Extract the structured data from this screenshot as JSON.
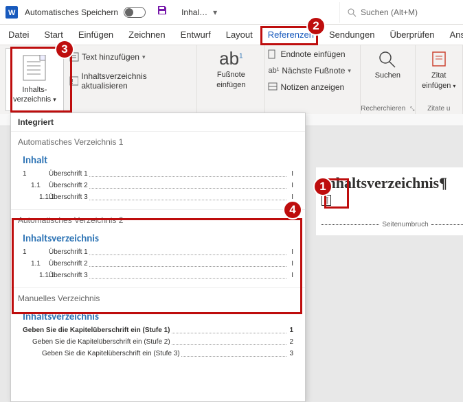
{
  "titlebar": {
    "autosave_label": "Automatisches Speichern",
    "doc_name": "Inhal…",
    "search_placeholder": "Suchen (Alt+M)"
  },
  "tabs": [
    "Datei",
    "Start",
    "Einfügen",
    "Zeichnen",
    "Entwurf",
    "Layout",
    "Referenzen",
    "Sendungen",
    "Überprüfen",
    "Ans"
  ],
  "active_tab": "Referenzen",
  "ribbon": {
    "toc_button_label_line1": "Inhalts-",
    "toc_button_label_line2": "verzeichnis",
    "text_add": "Text hinzufügen",
    "update_toc": "Inhaltsverzeichnis aktualisieren",
    "footnote_btn_line1": "Fußnote",
    "footnote_btn_line2": "einfügen",
    "endnote_insert": "Endnote einfügen",
    "next_footnote": "Nächste Fußnote",
    "show_notes": "Notizen anzeigen",
    "search": "Suchen",
    "research_caption": "Recherchieren",
    "cite_line1": "Zitat",
    "cite_line2": "einfügen",
    "cite_caption": "Zitate u"
  },
  "gallery": {
    "header": "Integriert",
    "auto1_caption": "Automatisches Verzeichnis 1",
    "auto1_title": "Inhalt",
    "auto2_caption": "Automatisches Verzeichnis 2",
    "auto2_title": "Inhaltsverzeichnis",
    "rows": [
      {
        "num": "1",
        "txt": "Überschrift 1",
        "pg": "I",
        "ind": ""
      },
      {
        "num": "1.1",
        "txt": "Überschrift 2",
        "pg": "I",
        "ind": "ind1"
      },
      {
        "num": "1.1.1",
        "txt": "Überschrift 3",
        "pg": "I",
        "ind": "ind2"
      }
    ],
    "manual_caption": "Manuelles Verzeichnis",
    "manual_title": "Inhaltsverzeichnis",
    "manual_rows": [
      {
        "txt": "Geben Sie die Kapitelüberschrift ein (Stufe 1)",
        "pg": "1",
        "cls": "n1"
      },
      {
        "txt": "Geben Sie die Kapitelüberschrift ein (Stufe 2)",
        "pg": "2",
        "cls": "n2"
      },
      {
        "txt": "Geben Sie die Kapitelüberschrift ein (Stufe 3)",
        "pg": "3",
        "cls": "n3"
      }
    ]
  },
  "document": {
    "heading": "Inhaltsverzeichnis¶",
    "pilcrow": "¶",
    "pagebreak": "Seitenumbruch"
  },
  "callouts": {
    "c1": "1",
    "c2": "2",
    "c3": "3",
    "c4": "4"
  }
}
